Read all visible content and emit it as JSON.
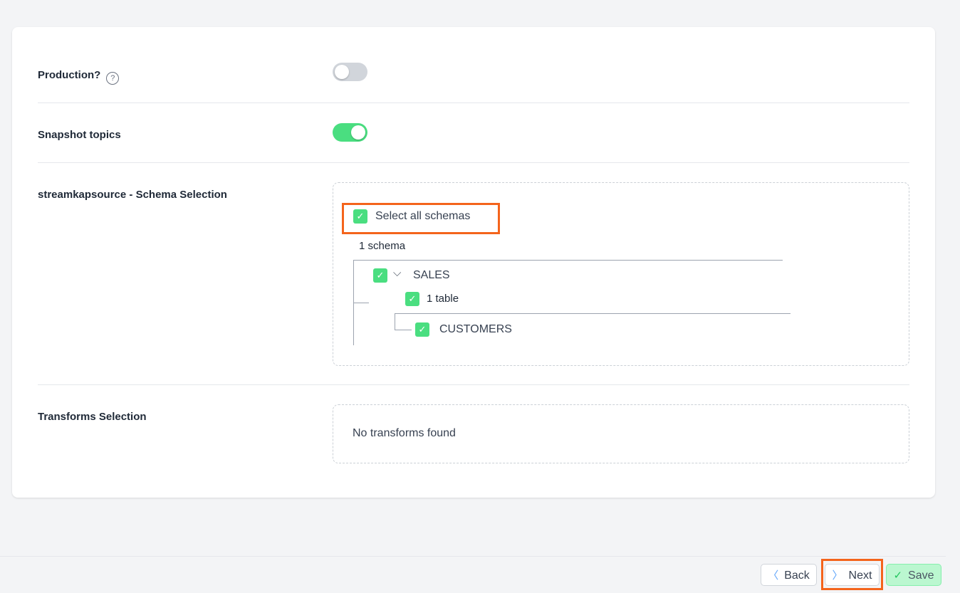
{
  "settings": {
    "production": {
      "label": "Production?",
      "help_icon": "?",
      "enabled": false
    },
    "snapshot": {
      "label": "Snapshot topics",
      "enabled": true
    },
    "schema_selection": {
      "label": "streamkapsource - Schema Selection",
      "select_all_label": "Select all schemas",
      "schema_count": "1 schema",
      "schemas": [
        {
          "name": "SALES",
          "checked": true,
          "table_count": "1 table",
          "tables": [
            {
              "name": "CUSTOMERS",
              "checked": true
            }
          ]
        }
      ]
    },
    "transforms": {
      "label": "Transforms Selection",
      "empty_message": "No transforms found"
    }
  },
  "icons": {
    "check": "✓",
    "chevron_down": "⌵",
    "chevron_left": "〈",
    "chevron_right": "〉"
  },
  "footer": {
    "back_label": "Back",
    "next_label": "Next",
    "save_label": "Save"
  },
  "colors": {
    "accent_green": "#4ade80",
    "highlight_orange": "#f4641c"
  }
}
